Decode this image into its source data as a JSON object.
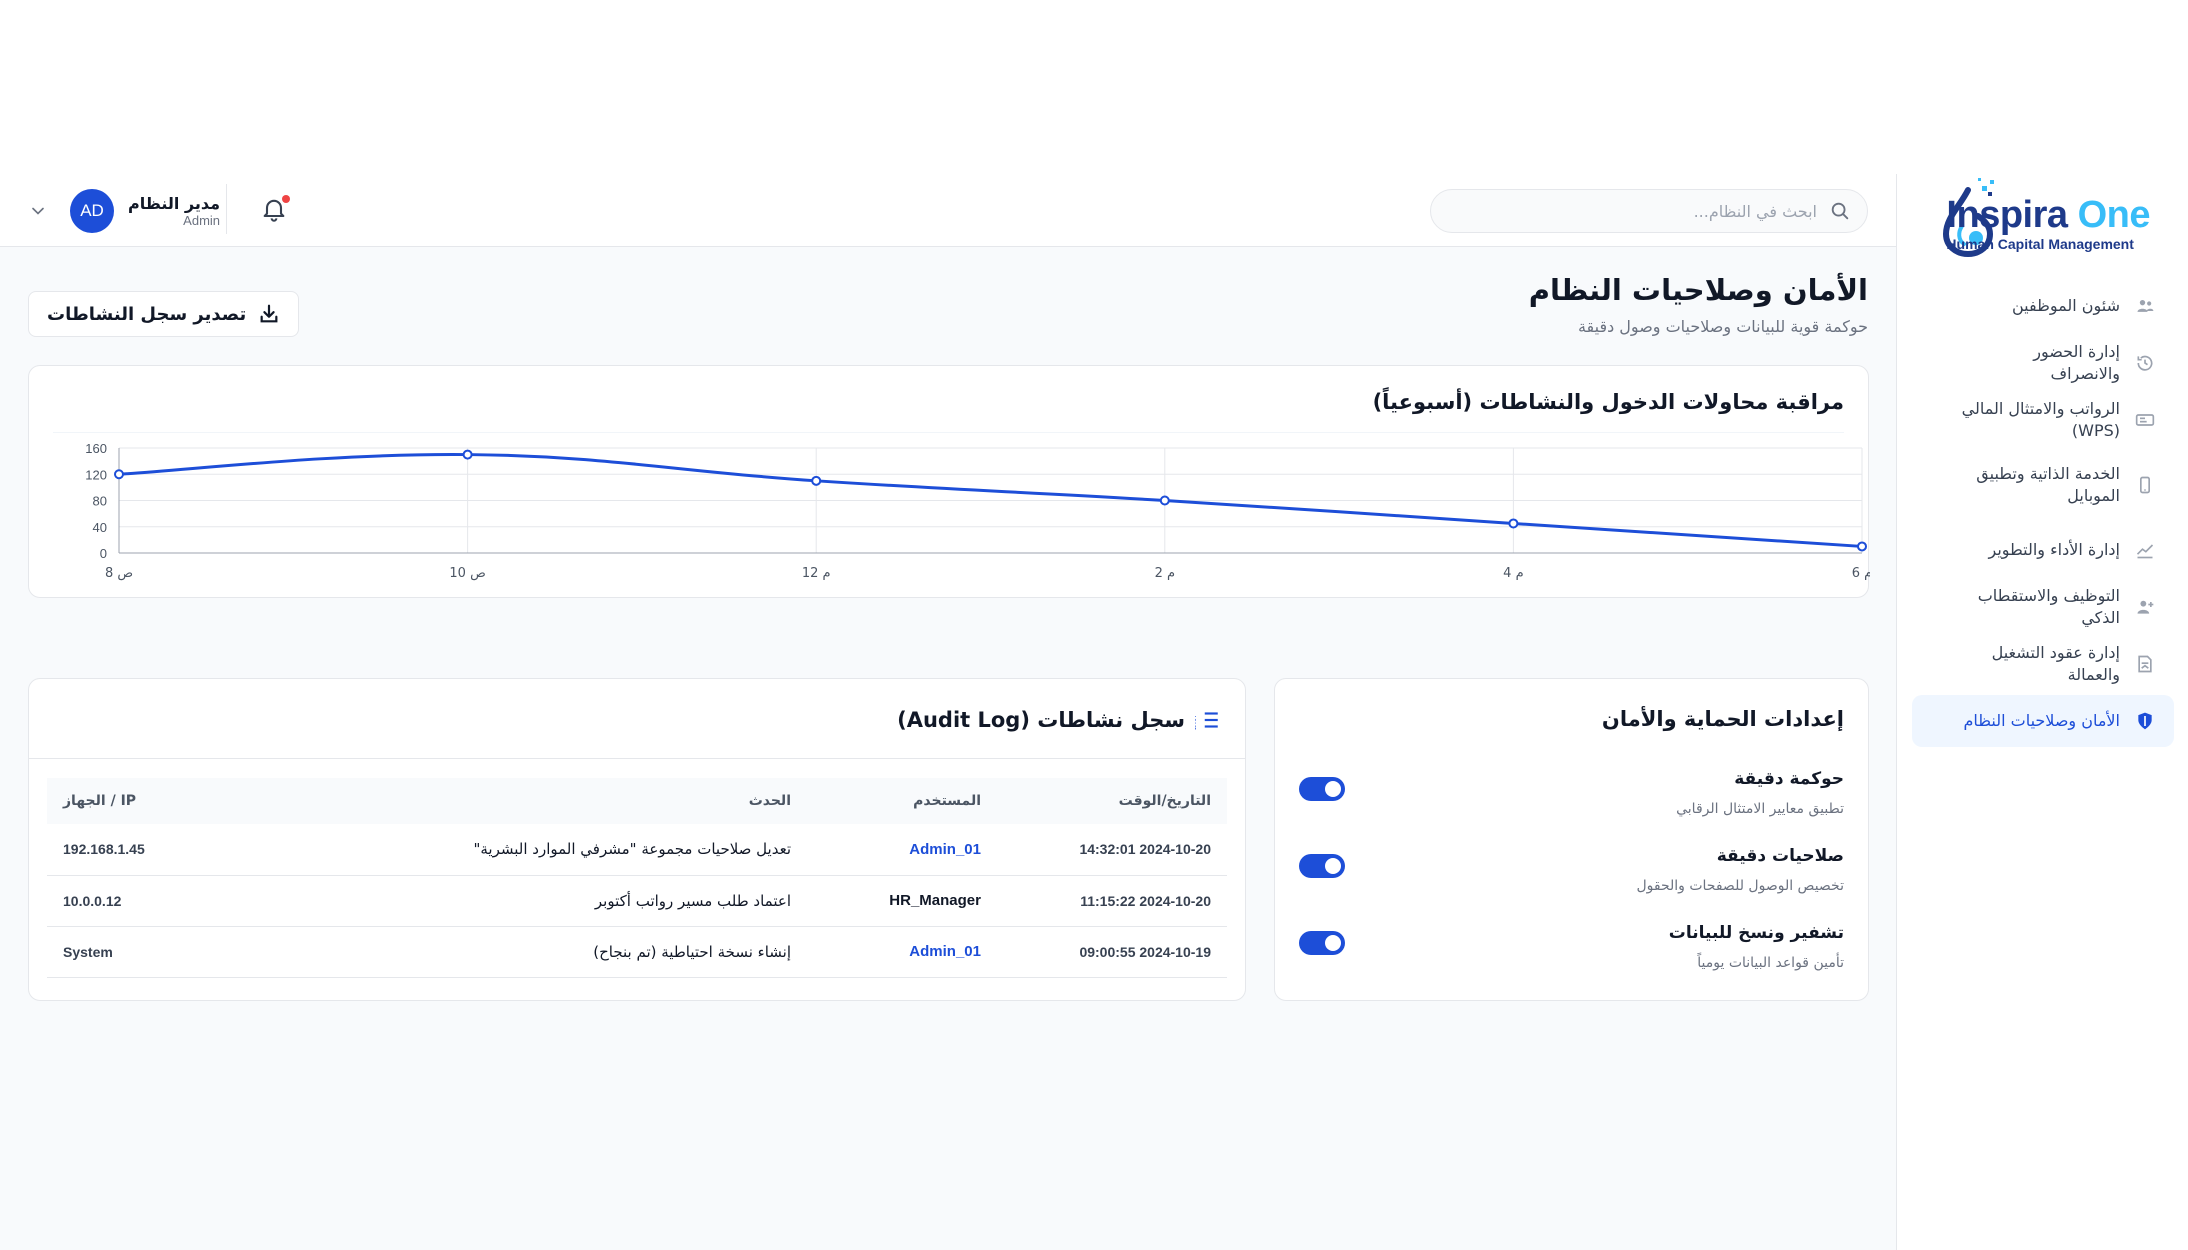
{
  "app": {
    "logo_main": "Inspira",
    "logo_accent": "One",
    "logo_sub": "Human Capital Management"
  },
  "sidebar": {
    "items": [
      {
        "label": "شئون الموظفين",
        "icon": "users-icon",
        "active": false
      },
      {
        "label": "إدارة الحضور والانصراف",
        "icon": "history-icon",
        "active": false
      },
      {
        "label": "الرواتب والامتثال المالي (WPS)",
        "icon": "money-icon",
        "active": false
      },
      {
        "label": "الخدمة الذاتية وتطبيق الموبايل",
        "icon": "mobile-icon",
        "active": false
      },
      {
        "label": "إدارة الأداء والتطوير",
        "icon": "chart-line-icon",
        "active": false
      },
      {
        "label": "التوظيف والاستقطاب الذكي",
        "icon": "user-plus-icon",
        "active": false
      },
      {
        "label": "إدارة عقود التشغيل والعمالة",
        "icon": "contract-icon",
        "active": false
      },
      {
        "label": "الأمان وصلاحيات النظام",
        "icon": "shield-icon",
        "active": true
      }
    ]
  },
  "header": {
    "search_placeholder": "ابحث في النظام...",
    "user_name": "مدير النظام",
    "user_role": "Admin",
    "user_initials": "AD"
  },
  "page": {
    "title": "الأمان وصلاحيات النظام",
    "subtitle": "حوكمة قوية للبيانات وصلاحيات وصول دقيقة",
    "export_label": "تصدير سجل النشاطات"
  },
  "chart_card": {
    "title": "مراقبة محاولات الدخول والنشاطات (أسبوعياً)"
  },
  "chart_data": {
    "type": "line",
    "categories": [
      "8 ص",
      "10 ص",
      "12 م",
      "2 م",
      "4 م",
      "6 م"
    ],
    "series": [
      {
        "values": [
          120,
          150,
          110,
          80,
          45,
          10
        ]
      }
    ],
    "ylim": [
      0,
      160
    ],
    "yticks": [
      0,
      40,
      80,
      120,
      160
    ],
    "grid": true,
    "color": "#1d4ed8"
  },
  "security": {
    "title": "إعدادات الحماية والأمان",
    "rows": [
      {
        "title": "حوكمة دقيقة",
        "desc": "تطبيق معايير الامتثال الرقابي",
        "enabled": true
      },
      {
        "title": "صلاحيات دقيقة",
        "desc": "تخصيص الوصول للصفحات والحقول",
        "enabled": true
      },
      {
        "title": "تشفير ونسخ للبيانات",
        "desc": "تأمين قواعد البيانات يومياً",
        "enabled": true
      }
    ]
  },
  "audit": {
    "title": "سجل نشاطات (Audit Log)",
    "columns": [
      "التاريخ/الوقت",
      "المستخدم",
      "الحدث",
      "IP / الجهاز"
    ],
    "rows": [
      {
        "datetime": "2024-10-20 14:32:01",
        "user": "Admin_01",
        "event": "تعديل صلاحيات مجموعة \"مشرفي الموارد البشرية\"",
        "ip": "192.168.1.45",
        "user_link": true
      },
      {
        "datetime": "2024-10-20 11:15:22",
        "user": "HR_Manager",
        "event": "اعتماد طلب مسير رواتب أكتوبر",
        "ip": "10.0.0.12",
        "user_link": false
      },
      {
        "datetime": "2024-10-19 09:00:55",
        "user": "Admin_01",
        "event": "إنشاء نسخة احتياطية (تم بنجاح)",
        "ip": "System",
        "user_link": true
      }
    ]
  }
}
